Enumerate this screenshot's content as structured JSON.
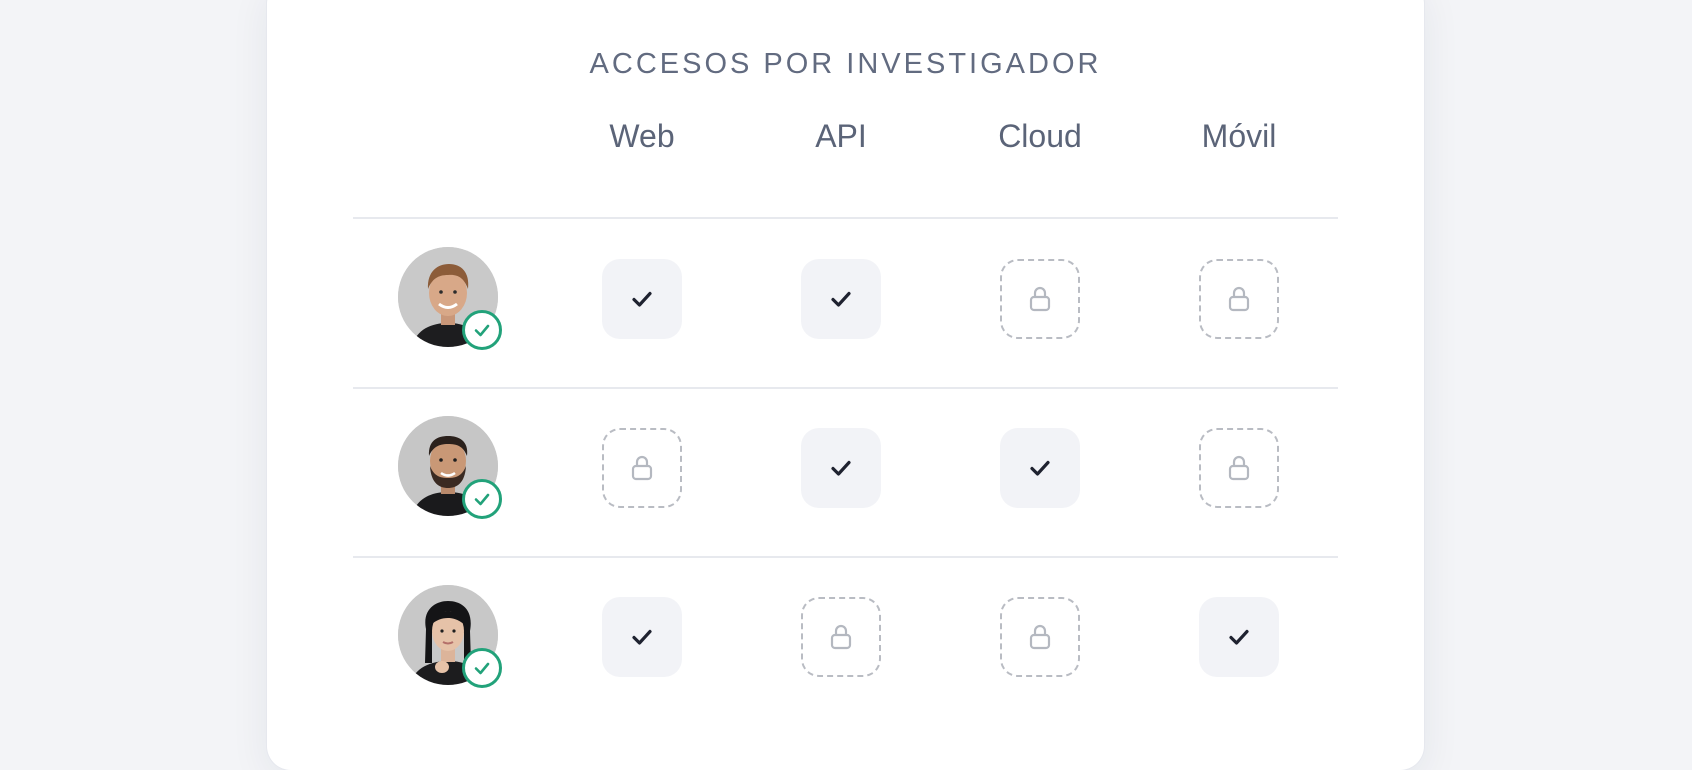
{
  "title": "ACCESOS POR INVESTIGADOR",
  "columns": [
    "Web",
    "API",
    "Cloud",
    "Móvil"
  ],
  "rows": [
    {
      "researcher": "researcher-1",
      "verified": true,
      "access": [
        "granted",
        "granted",
        "locked",
        "locked"
      ]
    },
    {
      "researcher": "researcher-2",
      "verified": true,
      "access": [
        "locked",
        "granted",
        "granted",
        "locked"
      ]
    },
    {
      "researcher": "researcher-3",
      "verified": true,
      "access": [
        "granted",
        "locked",
        "locked",
        "granted"
      ]
    }
  ],
  "icons": {
    "granted": "check-icon",
    "locked": "lock-icon",
    "verified": "check-circle-icon"
  },
  "colors": {
    "background": "#f3f4f7",
    "card": "#ffffff",
    "title": "#626b80",
    "header": "#5b6478",
    "granted_bg": "#f2f3f7",
    "check": "#1f2230",
    "lock": "#b4b8c0",
    "verified": "#22a27a",
    "divider": "#e7e9ee"
  }
}
